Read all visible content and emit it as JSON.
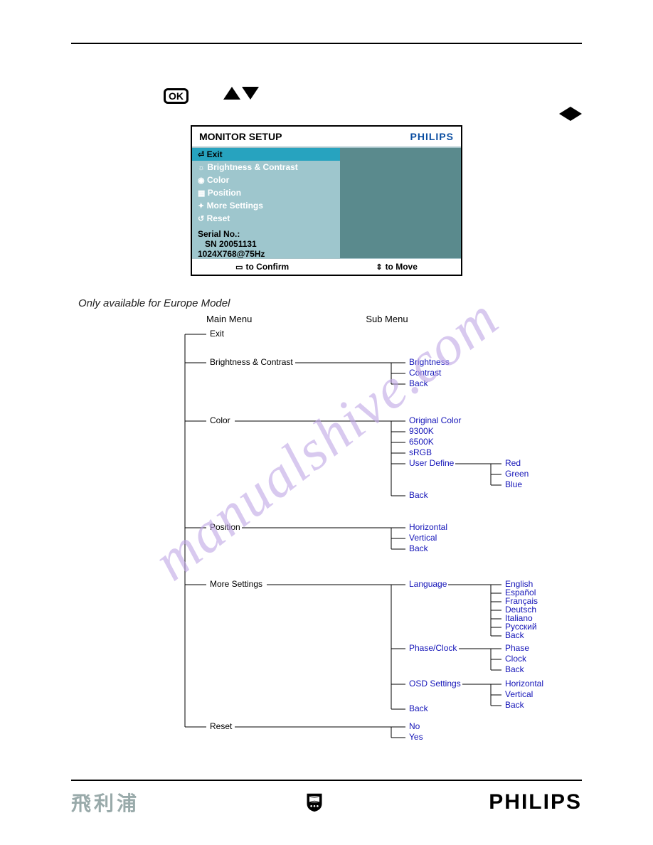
{
  "icons": {
    "ok_label": "OK"
  },
  "osd": {
    "title": "MONITOR SETUP",
    "brand": "PHILIPS",
    "items": [
      "Exit",
      "Brightness & Contrast",
      "Color",
      "Position",
      "More Settings",
      "Reset"
    ],
    "serial_label": "Serial No.:",
    "serial_value": "SN 20051131",
    "resolution": "1024X768@75Hz",
    "confirm_hint": "to Confirm",
    "move_hint": "to Move"
  },
  "tree": {
    "note": "Only available for Europe Model",
    "main_title": "Main Menu",
    "sub_title": "Sub Menu",
    "main": [
      "Exit",
      "Brightness & Contrast",
      "Color",
      "Position",
      "More Settings",
      "Reset"
    ],
    "brightness_sub": [
      "Brightness",
      "Contrast",
      "Back"
    ],
    "color_sub": [
      "Original Color",
      "9300K",
      "6500K",
      "sRGB",
      "User Define",
      "Back"
    ],
    "color_userdef_sub": [
      "Red",
      "Green",
      "Blue"
    ],
    "position_sub": [
      "Horizontal",
      "Vertical",
      "Back"
    ],
    "more_sub": [
      "Language",
      "Phase/Clock",
      "OSD Settings",
      "Back"
    ],
    "language_sub": [
      "English",
      "Español",
      "Français",
      "Deutsch",
      "Italiano",
      "Русский",
      "Back"
    ],
    "phaseclock_sub": [
      "Phase",
      "Clock",
      "Back"
    ],
    "osdsettings_sub": [
      "Horizontal",
      "Vertical",
      "Back"
    ],
    "reset_sub": [
      "No",
      "Yes"
    ]
  },
  "watermark": "manualshive.com",
  "footer": {
    "cjk": "飛利浦",
    "brand": "PHILIPS"
  }
}
